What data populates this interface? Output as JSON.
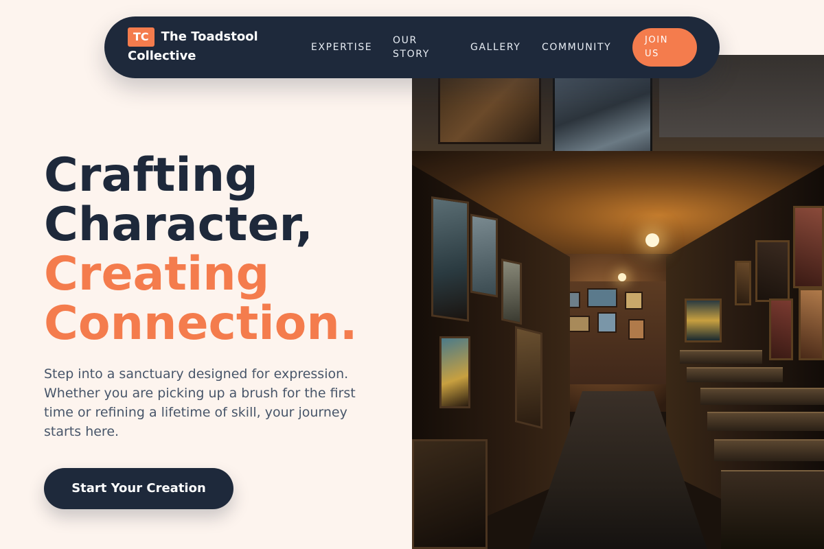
{
  "brand": {
    "badge": "TC",
    "name": "The Toadstool Collective"
  },
  "nav": {
    "items": [
      {
        "label": "EXPERTISE"
      },
      {
        "label": "OUR STORY"
      },
      {
        "label": "GALLERY"
      },
      {
        "label": "COMMUNITY"
      }
    ],
    "cta_label": "JOIN US"
  },
  "hero": {
    "headline_line1": "Crafting",
    "headline_line2": "Character,",
    "headline_line3": "Creating",
    "headline_line4": "Connection.",
    "description": "Step into a sanctuary designed for expression. Whether you are picking up a brush for the first time or refining a lifetime of skill, your journey starts here.",
    "cta_label": "Start Your Creation"
  },
  "colors": {
    "background": "#fdf4ee",
    "navy": "#1e293b",
    "accent": "#f47c4d",
    "body_text": "#475569"
  }
}
